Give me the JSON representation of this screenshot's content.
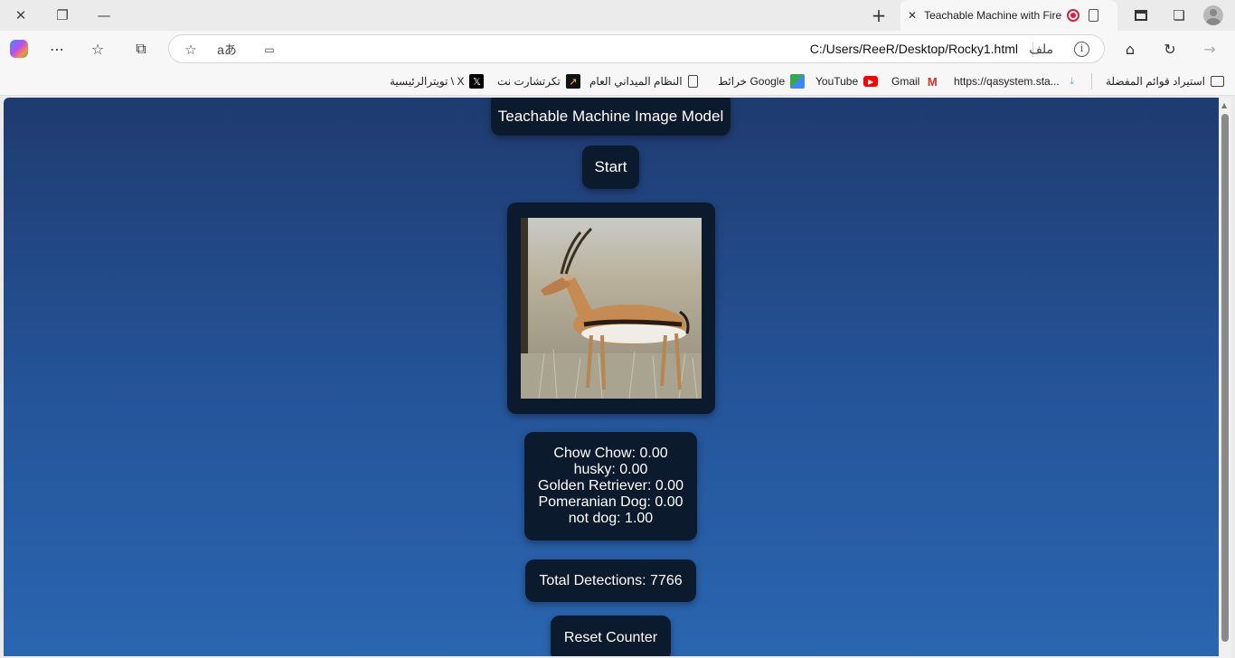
{
  "tab": {
    "title": "Teachable Machine with Firebase"
  },
  "address_bar": {
    "url": "C:/Users/ReeR/Desktop/Rocky1.html",
    "scheme_label": "ملف"
  },
  "bookmarks": [
    {
      "label": "استيراد قوائم المفضلة",
      "icon": "import-folder-icon"
    },
    {
      "label": "https://qasystem.sta...",
      "icon": "page-icon"
    },
    {
      "label": "Gmail",
      "icon": "gmail-icon"
    },
    {
      "label": "YouTube",
      "icon": "youtube-icon"
    },
    {
      "label": "خرائط Google",
      "icon": "maps-icon"
    },
    {
      "label": "النظام الميداني العام",
      "icon": "document-icon"
    },
    {
      "label": "تكرتشارت نت",
      "icon": "chart-icon"
    },
    {
      "label": "تويترالرئيسية \\ X",
      "icon": "x-icon"
    }
  ],
  "page": {
    "title": "Teachable Machine Image Model",
    "start_button": "Start",
    "predictions": [
      "Chow Chow: 0.00",
      "husky: 0.00",
      "Golden Retriever: 0.00",
      "Pomeranian Dog: 0.00",
      "not dog: 1.00"
    ],
    "total_detections": "Total Detections: 7766",
    "reset_button": "Reset Counter"
  },
  "colors": {
    "page_gradient_top": "#1f3b70",
    "page_gradient_bottom": "#2a66b0",
    "card_background": "#0c1a2e"
  }
}
